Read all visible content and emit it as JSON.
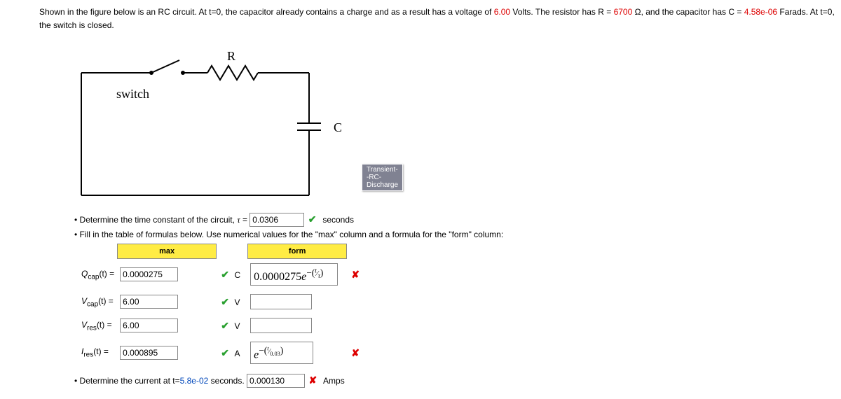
{
  "problem": {
    "intro1": "Shown in the figure below is an RC circuit. At t=0, the capacitor already contains a charge and as a result has a voltage of ",
    "v0": "6.00",
    "intro2": " Volts. The resistor has R = ",
    "R": "6700",
    "intro3": " Ω, and the capacitor has C = ",
    "C": "4.58e-06",
    "intro4": " Farads. At t=0, the switch is closed."
  },
  "circuit": {
    "switch": "switch",
    "R": "R",
    "C": "C",
    "tooltip": "Transient--RC-Discharge"
  },
  "bullets": {
    "b1_pre": "Determine the time constant of the circuit, ",
    "b1_tau": "τ",
    "b1_eq": " = ",
    "tau_val": "0.0306",
    "b1_unit": "seconds",
    "b2": "Fill in the table of formulas below. Use numerical values for the \"max\" column and a formula for the \"form\" column:",
    "b3_pre": "Determine the current at t=",
    "b3_t": "5.8e-02",
    "b3_post": " seconds. ",
    "b3_val": "0.000130",
    "b3_unit": "Amps"
  },
  "headers": {
    "max": "max",
    "form": "form"
  },
  "rows": {
    "qcap": {
      "label": "Q",
      "sub": "cap",
      "arg": "(t) = ",
      "max": "0.0000275",
      "unit": "C",
      "form_html": "0.0000275<i>e</i><sup>&minus;(<span style='font-size:11px'><sup><i>t</i></sup>&frasl;<sub><i>τ</i></sub></span>)</sup>"
    },
    "vcap": {
      "label": "V",
      "sub": "cap",
      "arg": "(t) = ",
      "max": "6.00",
      "unit": "V",
      "form": ""
    },
    "vres": {
      "label": "V",
      "sub": "res",
      "arg": "(t) = ",
      "max": "6.00",
      "unit": "V",
      "form": ""
    },
    "ires": {
      "label": "I",
      "sub": "res",
      "arg": "(t) = ",
      "max": "0.000895",
      "unit": "A",
      "form_html": "<i>e</i><sup>&minus;(<span style='font-size:10px'><sup><i>t</i></sup>&frasl;<sub>0.03</sub></span>)</sup>"
    }
  }
}
